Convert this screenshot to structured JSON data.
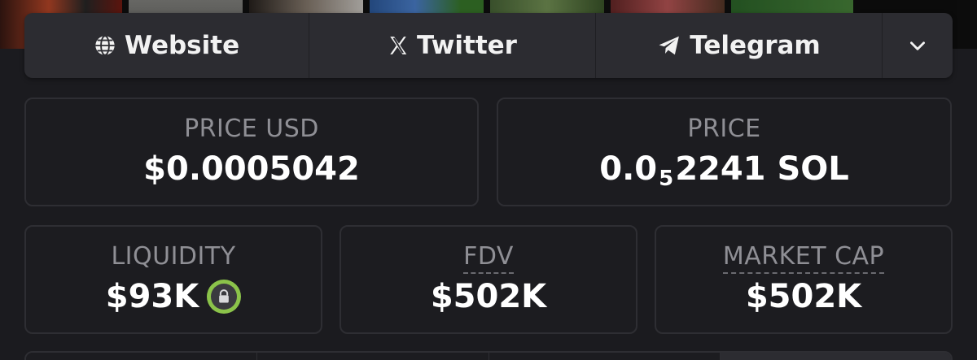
{
  "links": {
    "website": {
      "label": "Website",
      "icon": "globe-icon"
    },
    "twitter": {
      "label": "Twitter",
      "icon": "x-logo-icon"
    },
    "telegram": {
      "label": "Telegram",
      "icon": "telegram-icon"
    },
    "more": {
      "icon": "chevron-down-icon"
    }
  },
  "stats": {
    "price_usd": {
      "label": "PRICE USD",
      "value": "$0.0005042"
    },
    "price_native": {
      "label": "PRICE",
      "value_prefix": "0.0",
      "value_subscript": "5",
      "value_suffix": "2241 SOL"
    },
    "liquidity": {
      "label": "LIQUIDITY",
      "value": "$93K",
      "lock_icon": "lock-icon"
    },
    "fdv": {
      "label": "FDV",
      "value": "$502K"
    },
    "market_cap": {
      "label": "MARKET CAP",
      "value": "$502K"
    }
  },
  "colors": {
    "background": "#1b1b1f",
    "card_border": "#2e2e33",
    "label_gray": "#8f8f95",
    "lock_green": "#8bc34a",
    "linkbar_bg": "#2c2c31"
  }
}
